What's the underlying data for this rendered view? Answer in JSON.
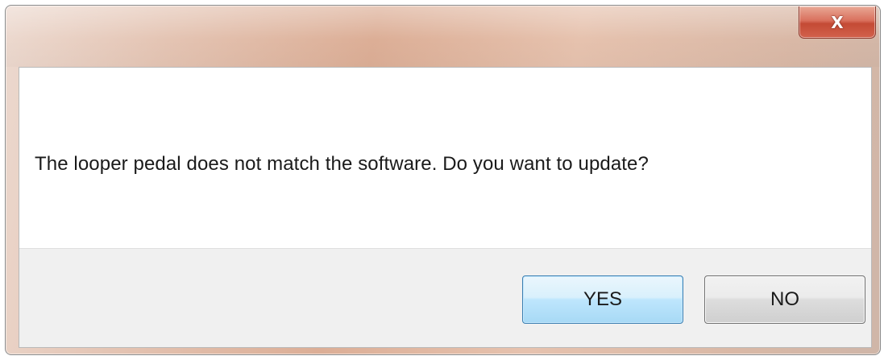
{
  "window": {
    "title": "",
    "close_label": "X"
  },
  "message": {
    "text": "The looper pedal does not match the software. Do you want to update?"
  },
  "buttons": {
    "yes_label": "YES",
    "no_label": "NO"
  },
  "colors": {
    "title_bar": "#dcae96",
    "close_button": "#c44a35",
    "default_button": "#bee6fd",
    "button_area": "#f0f0f0"
  }
}
